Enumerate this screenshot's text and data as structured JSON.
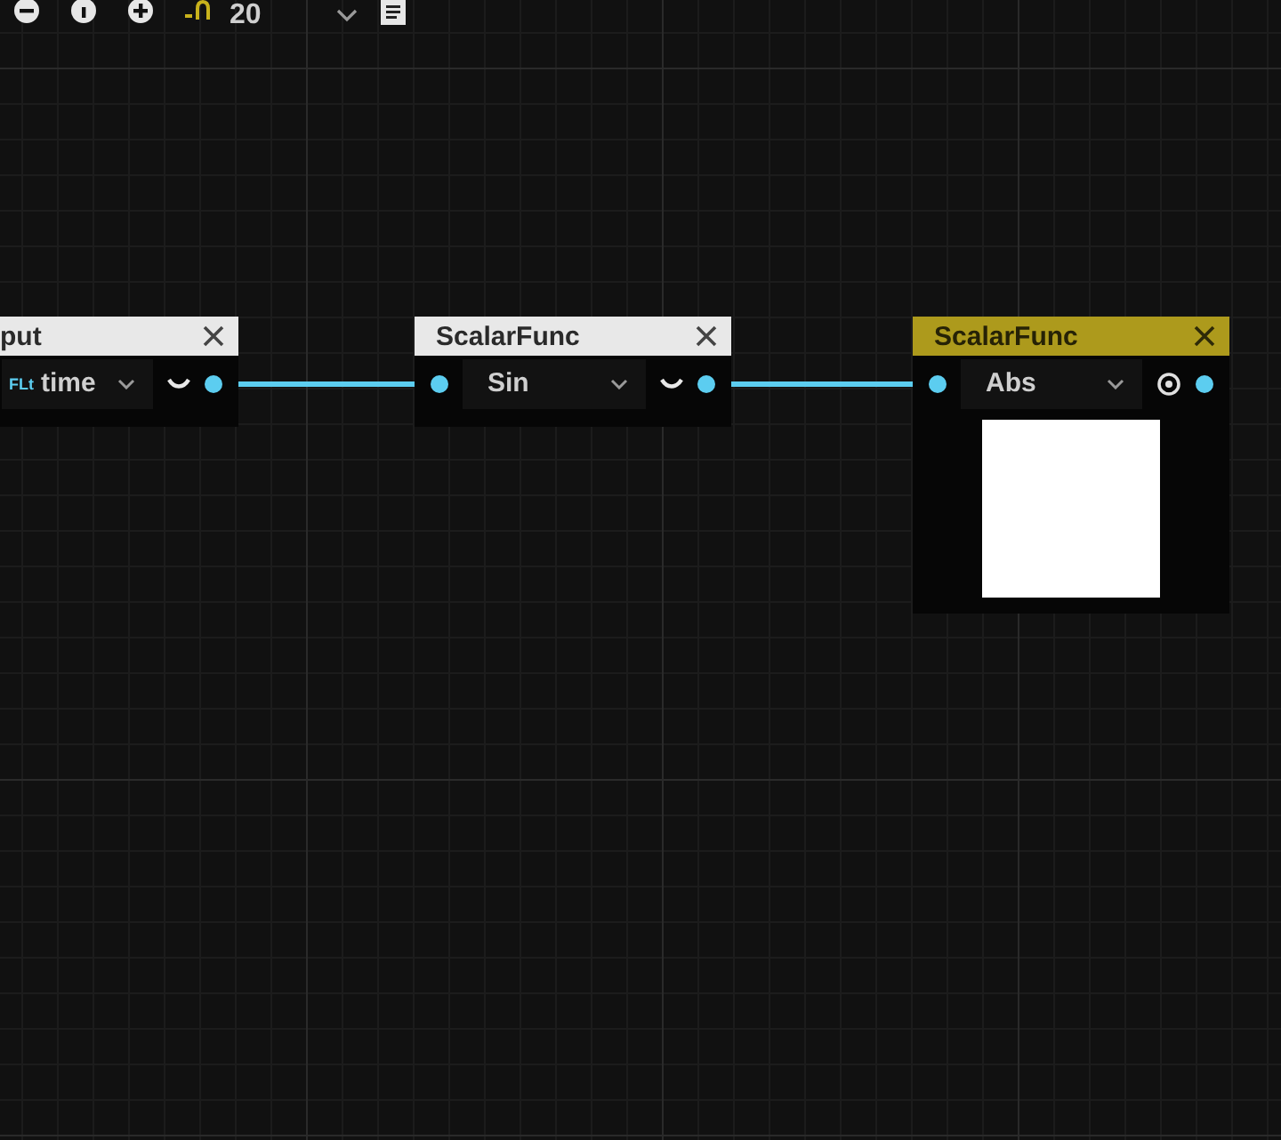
{
  "toolbar": {
    "zoom_value": "20"
  },
  "nodes": [
    {
      "title": "put",
      "selected": false,
      "kind": "input",
      "badge": "FLt",
      "value": "time"
    },
    {
      "title": "ScalarFunc",
      "selected": false,
      "kind": "func",
      "value": "Sin"
    },
    {
      "title": "ScalarFunc",
      "selected": true,
      "kind": "preview",
      "value": "Abs"
    }
  ]
}
